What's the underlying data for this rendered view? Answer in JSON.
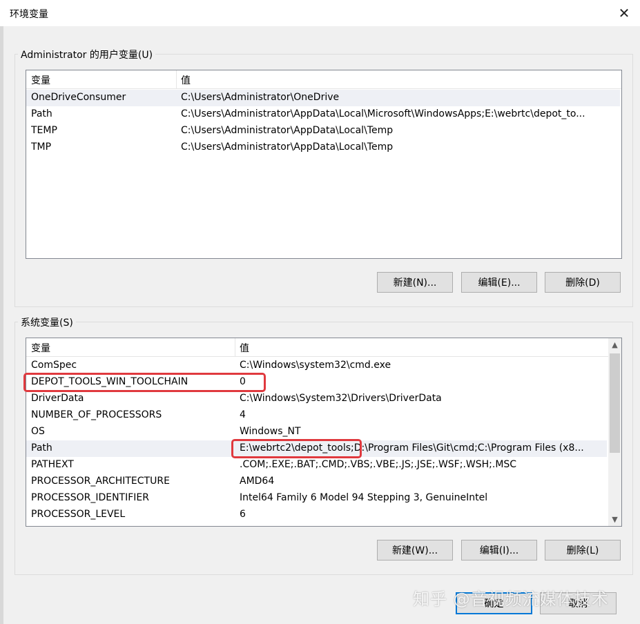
{
  "window": {
    "title": "环境变量",
    "close_icon": "✕"
  },
  "user_vars": {
    "group_label": "Administrator 的用户变量(U)",
    "headers": {
      "name": "变量",
      "value": "值"
    },
    "rows": [
      {
        "name": "OneDriveConsumer",
        "value": "C:\\Users\\Administrator\\OneDrive"
      },
      {
        "name": "Path",
        "value": "C:\\Users\\Administrator\\AppData\\Local\\Microsoft\\WindowsApps;E:\\webrtc\\depot_to..."
      },
      {
        "name": "TEMP",
        "value": "C:\\Users\\Administrator\\AppData\\Local\\Temp"
      },
      {
        "name": "TMP",
        "value": "C:\\Users\\Administrator\\AppData\\Local\\Temp"
      }
    ],
    "buttons": {
      "new": "新建(N)...",
      "edit": "编辑(E)...",
      "delete": "删除(D)"
    }
  },
  "system_vars": {
    "group_label": "系统变量(S)",
    "headers": {
      "name": "变量",
      "value": "值"
    },
    "rows": [
      {
        "name": "ComSpec",
        "value": "C:\\Windows\\system32\\cmd.exe"
      },
      {
        "name": "DEPOT_TOOLS_WIN_TOOLCHAIN",
        "value": "0"
      },
      {
        "name": "DriverData",
        "value": "C:\\Windows\\System32\\Drivers\\DriverData"
      },
      {
        "name": "NUMBER_OF_PROCESSORS",
        "value": "4"
      },
      {
        "name": "OS",
        "value": "Windows_NT"
      },
      {
        "name": "Path",
        "value": "E:\\webrtc2\\depot_tools;D:\\Program Files\\Git\\cmd;C:\\Program Files (x8..."
      },
      {
        "name": "PATHEXT",
        "value": ".COM;.EXE;.BAT;.CMD;.VBS;.VBE;.JS;.JSE;.WSF;.WSH;.MSC"
      },
      {
        "name": "PROCESSOR_ARCHITECTURE",
        "value": "AMD64"
      },
      {
        "name": "PROCESSOR_IDENTIFIER",
        "value": "Intel64 Family 6 Model 94 Stepping 3, GenuineIntel"
      },
      {
        "name": "PROCESSOR_LEVEL",
        "value": "6"
      }
    ],
    "buttons": {
      "new": "新建(W)...",
      "edit": "编辑(I)...",
      "delete": "删除(L)"
    },
    "scroll_up_icon": "▲",
    "scroll_down_icon": "▼"
  },
  "footer": {
    "ok": "确定",
    "cancel": "取消"
  },
  "watermark": "知乎 @音视频流媒体技术",
  "colors": {
    "highlight": "#e0393e",
    "accent": "#0078d7"
  }
}
